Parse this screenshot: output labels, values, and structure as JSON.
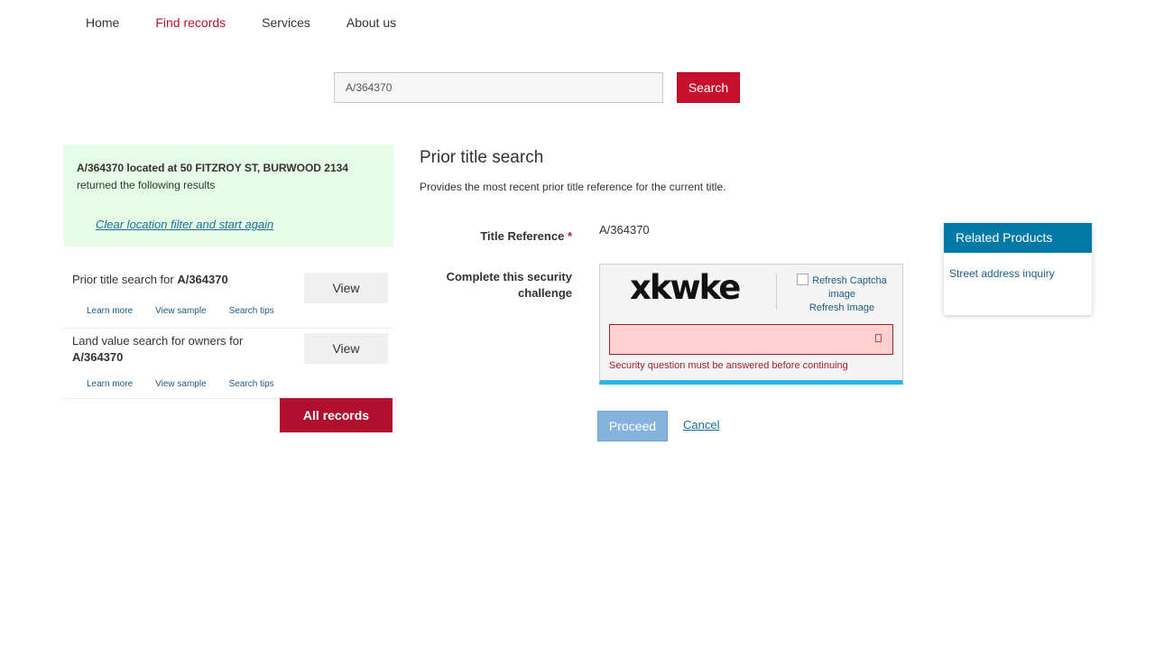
{
  "nav": {
    "items": [
      {
        "label": "Home"
      },
      {
        "label": "Find records"
      },
      {
        "label": "Services"
      },
      {
        "label": "About us"
      }
    ],
    "active_color": "#b8102e"
  },
  "search": {
    "value": "A/364370",
    "button_label": "Search"
  },
  "info": {
    "ref": "A/364370",
    "located_text": " located at 50 FITZROY ST, BURWOOD 2134",
    "returned_text": "returned the following results",
    "clear_link": "Clear location filter and start again"
  },
  "results": [
    {
      "title_prefix": "Prior title search for ",
      "title_ref": "A/364370",
      "view_label": "View",
      "links": [
        "Learn more",
        "View sample",
        "Search tips"
      ]
    },
    {
      "title_prefix": "Land value search for owners for ",
      "title_ref": "A/364370",
      "view_label": "View",
      "links": [
        "Learn more",
        "View sample",
        "Search tips"
      ]
    }
  ],
  "all_records_label": "All records",
  "main": {
    "title": "Prior title search",
    "description": "Provides the most recent prior title reference for the current title.",
    "title_reference_label": "Title Reference",
    "required_mark": "*",
    "title_reference_value": "A/364370",
    "security_label": "Complete this security challenge",
    "captcha_text": "xkwke",
    "refresh_alt": "Refresh Captcha image",
    "refresh_label": "Refresh Image",
    "error_text": "Security question must be answered before continuing",
    "proceed_label": "Proceed",
    "cancel_label": "Cancel"
  },
  "related": {
    "heading": "Related Products",
    "links": [
      "Street address inquiry"
    ]
  },
  "colors": {
    "brand_red": "#c8102e",
    "info_bg": "#e5fde5",
    "related_header": "#0079a6",
    "captcha_accent": "#2ab3e6",
    "error_bg": "#ffd1d1"
  }
}
